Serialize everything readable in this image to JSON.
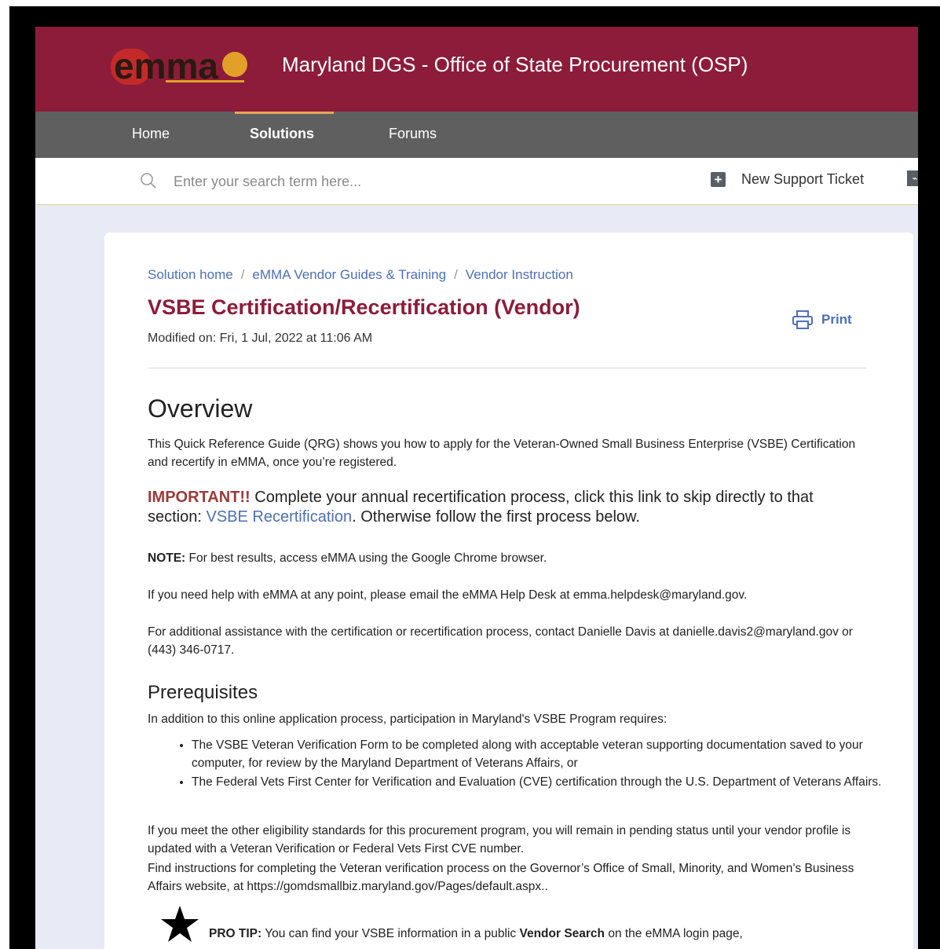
{
  "header": {
    "logo_text": "emma",
    "site_title": "Maryland DGS - Office of State Procurement (OSP)"
  },
  "nav": {
    "items": [
      {
        "label": "Home",
        "active": false
      },
      {
        "label": "Solutions",
        "active": true
      },
      {
        "label": "Forums",
        "active": false
      }
    ]
  },
  "search": {
    "placeholder": "Enter your search term here...",
    "new_ticket_label": "New Support Ticket"
  },
  "article": {
    "breadcrumb": [
      "Solution home",
      "eMMA Vendor Guides & Training",
      "Vendor Instruction"
    ],
    "title": "VSBE Certification/Recertification (Vendor)",
    "modified": "Modified on: Fri, 1 Jul, 2022 at 11:06 AM",
    "print_label": "Print",
    "overview_heading": "Overview",
    "overview_text": "This Quick Reference Guide (QRG) shows you how to apply for the Veteran-Owned Small Business Enterprise (VSBE) Certification and recertify in eMMA, once you’re registered.",
    "important_label": "IMPORTANT!!",
    "important_text_1": " Complete your annual recertification process, click this link to skip directly to that section: ",
    "important_link": "VSBE Recertification",
    "important_text_2": ". Otherwise follow the first process below.",
    "note_label": "NOTE:",
    "note_text": " For best results, access eMMA using the Google Chrome browser.",
    "help_text": "If you need help with eMMA at any point, please email the eMMA Help Desk at emma.helpdesk@maryland.gov.",
    "assist_text": "For additional assistance with the certification or recertification process, contact Danielle Davis at danielle.davis2@maryland.gov or (443) 346-0717.",
    "prereq_heading": "Prerequisites",
    "prereq_intro": "In addition to this online application process, participation in Maryland's VSBE Program requires:",
    "prereq_items": [
      "The VSBE Veteran Verification Form to be completed along with acceptable veteran supporting documentation saved to your computer, for review by the Maryland Department of Veterans Affairs, or",
      "The Federal Vets First Center for Verification and Evaluation (CVE) certification through the U.S. Department of Veterans Affairs."
    ],
    "eligibility_text": " If you meet the other eligibility standards for this procurement program, you will remain in pending status until your vendor profile is updated with a Veteran Verification or Federal Vets First CVE number.",
    "instructions_text": " Find instructions for completing the Veteran verification process on the Governor’s Office of Small, Minority, and Women’s Business Affairs website, at https://gomdsmallbiz.maryland.gov/Pages/default.aspx..",
    "protip_label": "PRO TIP:",
    "protip_text_1": " You can find your VSBE information in a public ",
    "protip_bold": "Vendor Search",
    "protip_text_2": " on the eMMA login page,"
  },
  "colors": {
    "header_bg": "#8c1c3a",
    "nav_bg": "#5f5f5f",
    "nav_active_underline": "#e3a85a",
    "link": "#4d6fb5",
    "title": "#8c1c3a"
  }
}
